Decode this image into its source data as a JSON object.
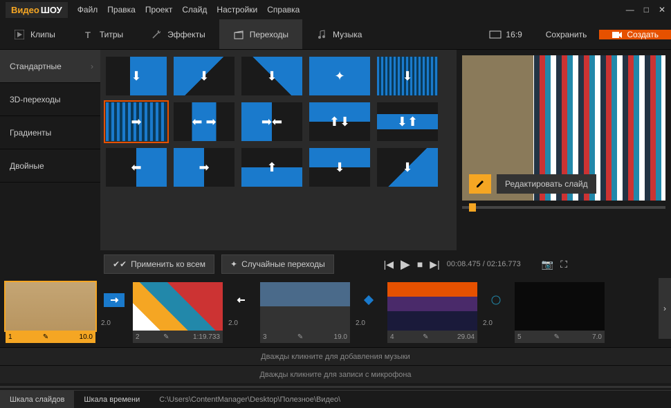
{
  "app": {
    "logo1": "Видео",
    "logo2": "ШОУ"
  },
  "menu": [
    "Файл",
    "Правка",
    "Проект",
    "Слайд",
    "Настройки",
    "Справка"
  ],
  "tabs": {
    "clips": "Клипы",
    "titles": "Титры",
    "effects": "Эффекты",
    "transitions": "Переходы",
    "music": "Музыка"
  },
  "aspect": "16:9",
  "save": "Сохранить",
  "create": "Создать",
  "sidebar": {
    "items": [
      "Стандартные",
      "3D-переходы",
      "Градиенты",
      "Двойные"
    ]
  },
  "edit_slide": "Редактировать слайд",
  "apply_all": "Применить ко всем",
  "random_trans": "Случайные переходы",
  "timecode": "00:08.475 / 02:16.773",
  "timeline": {
    "clips": [
      {
        "num": "1",
        "dur": "10.0"
      },
      {
        "num": "2",
        "dur": "1:19.733"
      },
      {
        "num": "3",
        "dur": "19.0"
      },
      {
        "num": "4",
        "dur": "29.04"
      },
      {
        "num": "5",
        "dur": "7.0"
      }
    ],
    "trans_dur": "2.0"
  },
  "music_hint": "Дважды кликните для добавления музыки",
  "mic_hint": "Дважды кликните для записи с микрофона",
  "bottom": {
    "slides": "Шкала слайдов",
    "time": "Шкала времени",
    "path": "C:\\Users\\ContentManager\\Desktop\\Полезное\\Видео\\"
  }
}
